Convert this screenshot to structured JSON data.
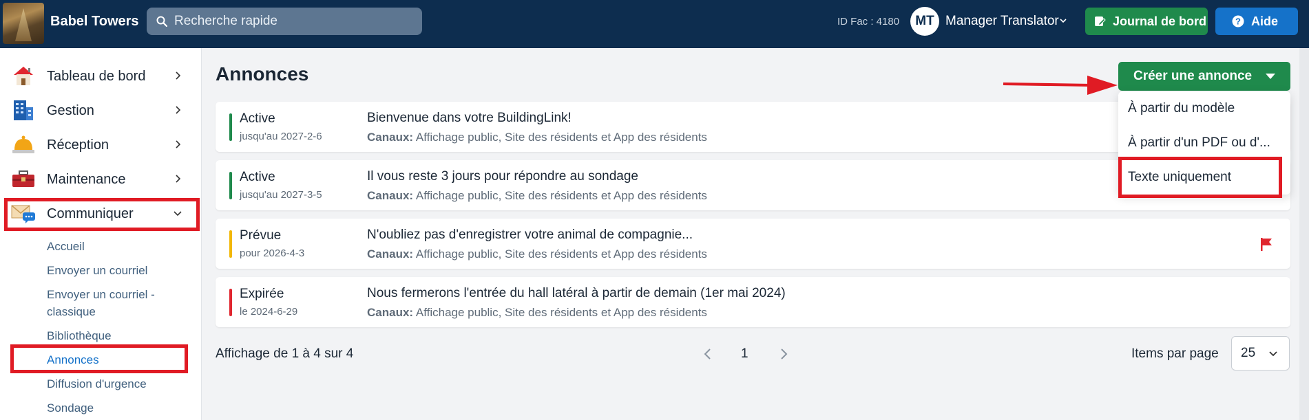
{
  "header": {
    "app_name": "Babel Towers",
    "search_placeholder": "Recherche rapide",
    "facility_id": "ID Fac : 4180",
    "user_initials": "MT",
    "user_name": "Manager Translator",
    "logbook_button": "Journal de bord",
    "help_button": "Aide"
  },
  "sidebar": {
    "items": [
      {
        "label": "Tableau de bord",
        "icon": "house-icon"
      },
      {
        "label": "Gestion",
        "icon": "building-icon"
      },
      {
        "label": "Réception",
        "icon": "bell-icon"
      },
      {
        "label": "Maintenance",
        "icon": "toolbox-icon"
      },
      {
        "label": "Communiquer",
        "icon": "envelope-chat-icon"
      }
    ],
    "sub_items": [
      "Accueil",
      "Envoyer un courriel",
      "Envoyer un courriel -",
      "classique",
      "Bibliothèque",
      "Annonces",
      "Diffusion d'urgence",
      "Sondage"
    ]
  },
  "main": {
    "title": "Annonces",
    "create_button": "Créer une annonce",
    "dropdown_items": [
      "À partir du modèle",
      "À partir d'un PDF ou d'...",
      "Texte uniquement"
    ],
    "channels_label": "Canaux:",
    "announcements": [
      {
        "status": "Active",
        "date": "jusqu'au 2027-2-6",
        "title": "Bienvenue dans votre BuildingLink!",
        "channels": "Affichage public, Site des résidents et App des résidents",
        "status_color": "#1f8a4c"
      },
      {
        "status": "Active",
        "date": "jusqu'au 2027-3-5",
        "title": "Il vous reste 3 jours pour répondre au sondage",
        "channels": "Affichage public, Site des résidents et App des résidents",
        "status_color": "#1f8a4c"
      },
      {
        "status": "Prévue",
        "date": "pour 2026-4-3",
        "title": "N'oubliez pas d'enregistrer votre animal de compagnie...",
        "channels": "Affichage public, Site des résidents et App des résidents",
        "status_color": "#f2b705"
      },
      {
        "status": "Expirée",
        "date": "le 2024-6-29",
        "title": "Nous fermerons l'entrée du hall latéral à partir de demain (1er mai 2024)",
        "channels": "Affichage public, Site des résidents et App des résidents",
        "status_color": "#e0262f"
      }
    ],
    "footer_count": "Affichage de 1 à 4 sur 4",
    "current_page": "1",
    "items_per_page_label": "Items par page",
    "items_per_page_value": "25"
  },
  "colors": {
    "header_bg": "#0d2d4f",
    "accent_green": "#1f8a4c",
    "accent_blue": "#1572c9",
    "highlight_red": "#e01b24"
  }
}
